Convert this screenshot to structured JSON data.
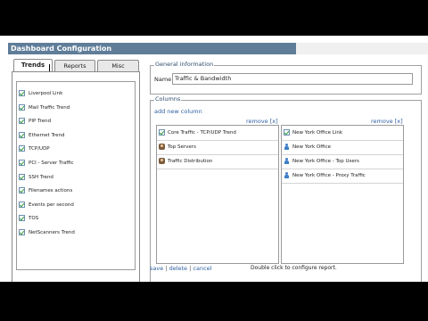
{
  "title": "Dashboard Configuration",
  "tabs": [
    {
      "label": "Trends",
      "active": true
    },
    {
      "label": "Reports",
      "active": false
    },
    {
      "label": "Misc",
      "active": false
    }
  ],
  "trends": [
    "Liverpool Link",
    "Mail Traffic Trend",
    "PIP Trend",
    "Ethernet Trend",
    "TCP/UDP",
    "PCI - Server Traffic",
    "SSH Trend",
    "Filenames actions",
    "Events per second",
    "TOS",
    "NetScanners Trend"
  ],
  "general": {
    "legend": "General information",
    "name_label": "Name",
    "name_value": "Traffic & Bandwidth"
  },
  "columns": {
    "legend": "Columns",
    "add_link": "add new column",
    "remove_label": "remove [x]",
    "left": [
      {
        "label": "Core Traffic - TCP/UDP Trend",
        "icon": "check-icon"
      },
      {
        "label": "Top Servers",
        "icon": "people-icon"
      },
      {
        "label": "Traffic Distribution",
        "icon": "people-icon"
      }
    ],
    "right": [
      {
        "label": "New York Office Link",
        "icon": "check-icon"
      },
      {
        "label": "New York Office",
        "icon": "user-icon"
      },
      {
        "label": "New York Office - Top Users",
        "icon": "user-icon"
      },
      {
        "label": "New York Office - Proxy Traffic",
        "icon": "user-icon"
      }
    ]
  },
  "footer": {
    "save": "save",
    "delete": "delete",
    "cancel": "cancel",
    "separator": "|",
    "hint": "Double click to configure report."
  },
  "colors": {
    "titlebar": "#5f7d99",
    "link": "#2e5fa0",
    "check": "#2f9a3a"
  }
}
